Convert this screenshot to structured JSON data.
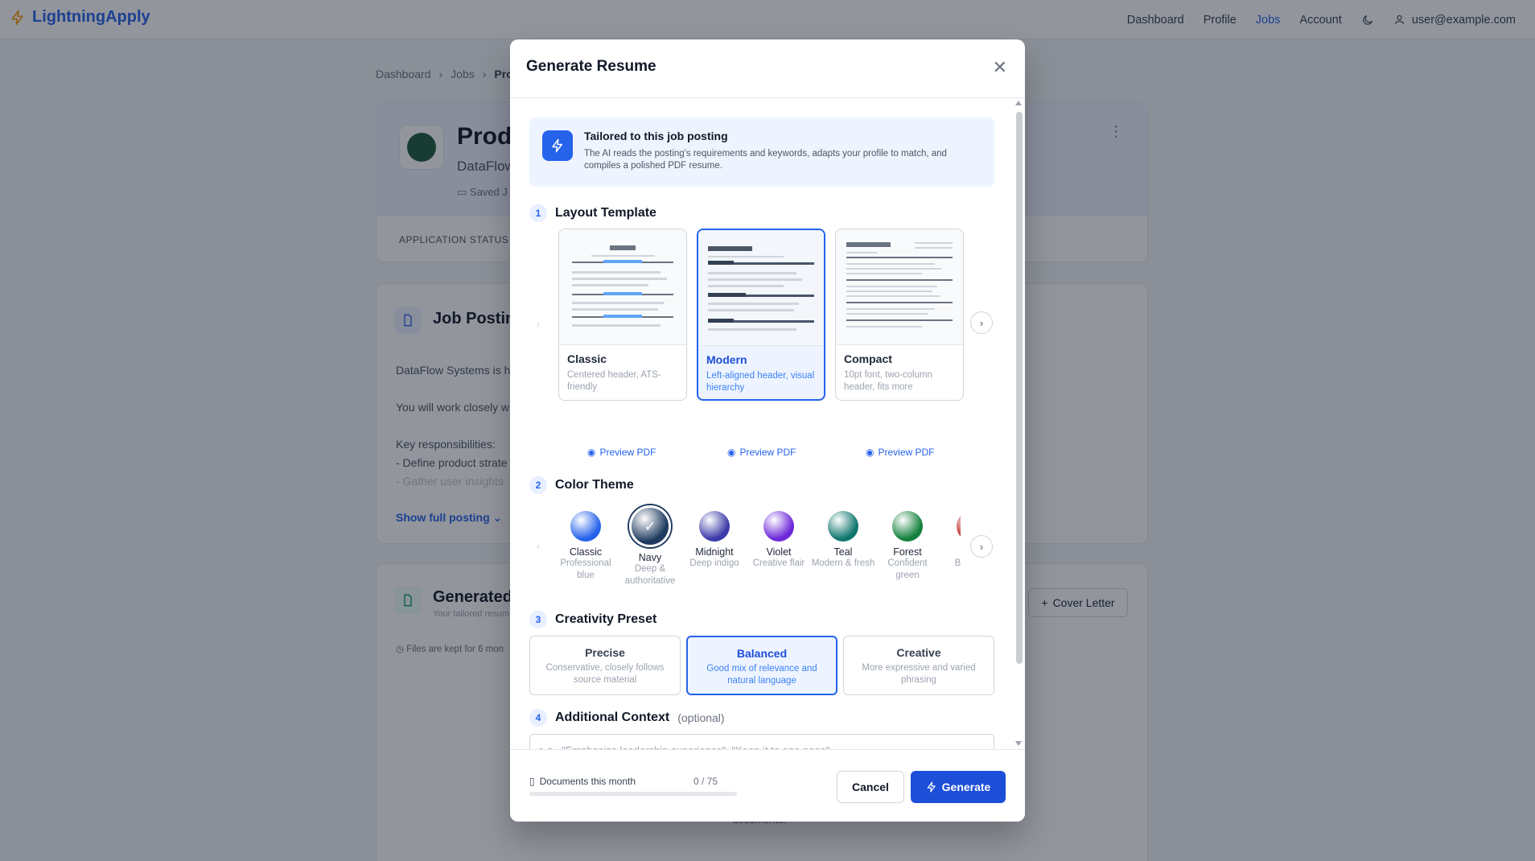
{
  "app": {
    "name": "LightningApply",
    "brand_color": "#2563eb"
  },
  "nav": {
    "items": [
      {
        "label": "Dashboard",
        "active": false
      },
      {
        "label": "Profile",
        "active": false
      },
      {
        "label": "Jobs",
        "active": true
      },
      {
        "label": "Account",
        "active": false
      }
    ],
    "theme_icon": "moon-icon",
    "user_email": "user@example.com"
  },
  "breadcrumb": [
    "Dashboard",
    "Jobs",
    "Prod"
  ],
  "job": {
    "title": "Prod",
    "company": "DataFlow",
    "saved": "Saved J",
    "application_status_label": "APPLICATION STATUS"
  },
  "posting": {
    "title": "Job Posting",
    "lines": [
      "DataFlow Systems is hir",
      "",
      "You will work closely wi",
      "",
      "Key responsibilities:",
      "- Define product strate",
      "- Gather user insights"
    ],
    "show_more": "Show full posting"
  },
  "generated": {
    "title": "Generated",
    "subtitle": "Your tailored resum",
    "files_note": "Files are kept for 6 mon",
    "cover_letter": "Cover Letter",
    "docs_text": "documents."
  },
  "modal": {
    "title": "Generate Resume",
    "info_title": "Tailored to this job posting",
    "info_desc": "The AI reads the posting's requirements and keywords, adapts your profile to match, and compiles a polished PDF resume.",
    "sections": {
      "layout": {
        "num": "1",
        "label": "Layout Template"
      },
      "color": {
        "num": "2",
        "label": "Color Theme"
      },
      "creativity": {
        "num": "3",
        "label": "Creativity Preset"
      },
      "context": {
        "num": "4",
        "label": "Additional Context",
        "optional": "(optional)"
      }
    },
    "templates": [
      {
        "name": "Classic",
        "desc": "Centered header, ATS-friendly",
        "preview": "Preview PDF",
        "selected": false
      },
      {
        "name": "Modern",
        "desc": "Left-aligned header, visual hierarchy",
        "preview": "Preview PDF",
        "selected": true
      },
      {
        "name": "Compact",
        "desc": "10pt font, two-column header, fits more",
        "preview": "Preview PDF",
        "selected": false
      }
    ],
    "colors": [
      {
        "name": "Classic",
        "desc": "Professional blue",
        "color": "#2563eb",
        "selected": false
      },
      {
        "name": "Navy",
        "desc": "Deep & authoritative",
        "color": "#1e3a5f",
        "selected": true
      },
      {
        "name": "Midnight",
        "desc": "Deep indigo",
        "color": "#3b3aa8",
        "selected": false
      },
      {
        "name": "Violet",
        "desc": "Creative flair",
        "color": "#6d28d9",
        "selected": false
      },
      {
        "name": "Teal",
        "desc": "Modern & fresh",
        "color": "#0f766e",
        "selected": false
      },
      {
        "name": "Forest",
        "desc": "Confident green",
        "color": "#15803d",
        "selected": false
      },
      {
        "name": "Cri",
        "desc": "Bo mem",
        "color": "#b91c1c",
        "selected": false
      }
    ],
    "presets": [
      {
        "name": "Precise",
        "desc": "Conservative, closely follows source material",
        "selected": false
      },
      {
        "name": "Balanced",
        "desc": "Good mix of relevance and natural language",
        "selected": true
      },
      {
        "name": "Creative",
        "desc": "More expressive and varied phrasing",
        "selected": false
      }
    ],
    "context_placeholder": "e.g., \"Emphasize leadership experience\", \"Keep it to one page\"",
    "usage_label": "Documents this month",
    "usage_count": "0 / 75",
    "usage_fraction": 0,
    "cancel": "Cancel",
    "generate": "Generate"
  }
}
